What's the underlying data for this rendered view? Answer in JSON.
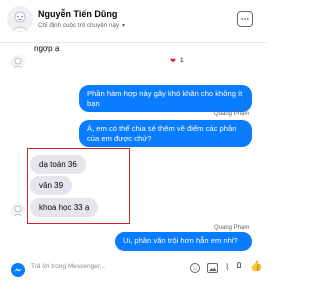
{
  "header": {
    "name": "Nguyễn Tiến Dũng",
    "subtitle": "Chỉ định cuộc trò chuyện này"
  },
  "messages": [
    {
      "side": "in",
      "text": "ngợp ạ",
      "reaction": "❤1"
    },
    {
      "side": "out",
      "text": "Phần hàm hợp này gây khó khăn cho không ít bạn"
    },
    {
      "side": "out",
      "sender": "Quang Phạm",
      "text": "À, em có thể chia sẻ thêm về điểm các phần của em được chứ?"
    },
    {
      "side": "in",
      "text": "dạ toán 36"
    },
    {
      "side": "in",
      "text": "văn 39"
    },
    {
      "side": "in",
      "text": "khoa học 33 ạ"
    },
    {
      "side": "out",
      "sender": "Quang Phạm",
      "text": "Ui, phần văn trội hơn hẳn em nhỉ?"
    }
  ],
  "composer": {
    "placeholder": "Trả lời trong Messenger..."
  },
  "colors": {
    "accent": "#0a7cff",
    "highlight": "#d2232a",
    "incoming_bubble": "#e4e6eb"
  }
}
